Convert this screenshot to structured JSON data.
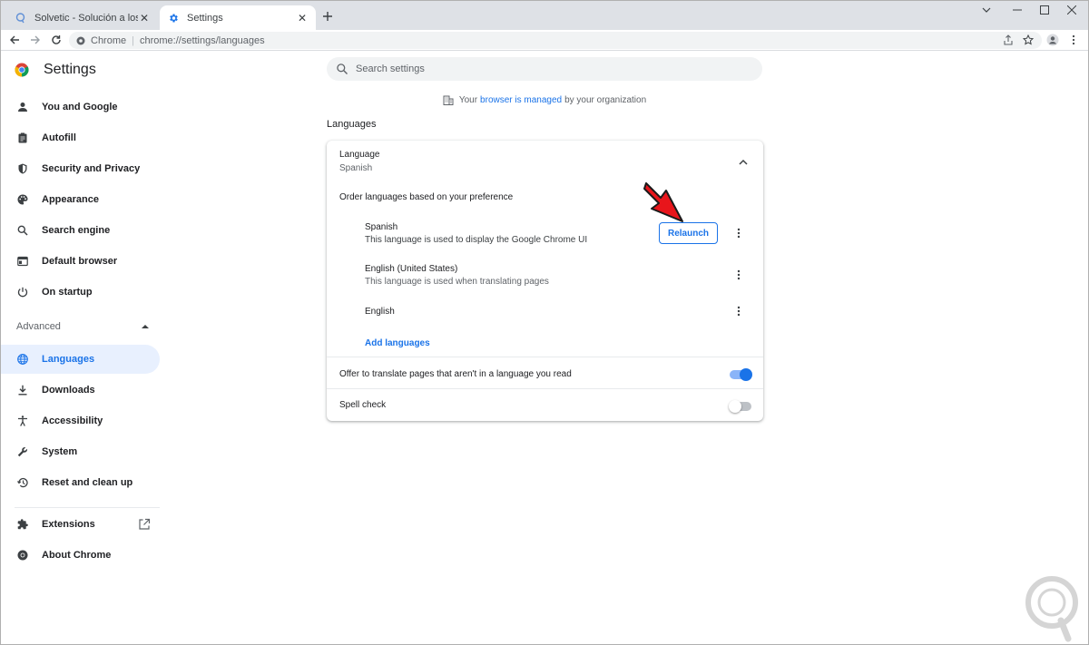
{
  "tabs": [
    {
      "title": "Solvetic - Solución a los problem",
      "icon": "solvetic-icon"
    },
    {
      "title": "Settings",
      "icon": "gear-icon"
    }
  ],
  "toolbar": {
    "omnibox_chip": "Chrome",
    "url": "chrome://settings/languages"
  },
  "sidebar": {
    "brand": "Settings",
    "items": [
      {
        "label": "You and Google",
        "icon": "person-icon"
      },
      {
        "label": "Autofill",
        "icon": "clipboard-icon"
      },
      {
        "label": "Security and Privacy",
        "icon": "shield-icon"
      },
      {
        "label": "Appearance",
        "icon": "palette-icon"
      },
      {
        "label": "Search engine",
        "icon": "search-icon"
      },
      {
        "label": "Default browser",
        "icon": "browser-icon"
      },
      {
        "label": "On startup",
        "icon": "power-icon"
      }
    ],
    "advanced_label": "Advanced",
    "advanced_items": [
      {
        "label": "Languages",
        "icon": "globe-icon",
        "selected": true
      },
      {
        "label": "Downloads",
        "icon": "download-icon"
      },
      {
        "label": "Accessibility",
        "icon": "accessibility-icon"
      },
      {
        "label": "System",
        "icon": "wrench-icon"
      },
      {
        "label": "Reset and clean up",
        "icon": "restore-icon"
      }
    ],
    "extra_items": [
      {
        "label": "Extensions",
        "icon": "puzzle-icon"
      },
      {
        "label": "About Chrome",
        "icon": "chrome-icon"
      }
    ]
  },
  "main": {
    "search_placeholder": "Search settings",
    "managed": {
      "prefix": "Your",
      "link": "browser is managed",
      "suffix": "by your organization"
    },
    "section_title": "Languages",
    "card": {
      "language_label": "Language",
      "language_value": "Spanish",
      "order_label": "Order languages based on your preference",
      "languages": [
        {
          "name": "Spanish",
          "desc": "This language is used to display the Google Chrome UI"
        },
        {
          "name": "English (United States)",
          "desc": "This language is used when translating pages"
        },
        {
          "name": "English",
          "desc": ""
        }
      ],
      "relaunch_label": "Relaunch",
      "add_languages_label": "Add languages",
      "translate_label": "Offer to translate pages that aren't in a language you read",
      "translate_on": true,
      "spellcheck_label": "Spell check",
      "spellcheck_on": false
    }
  },
  "colors": {
    "accent": "#1a73e8",
    "selected_bg": "#e8f0fe",
    "arrow": "#e8151b"
  }
}
